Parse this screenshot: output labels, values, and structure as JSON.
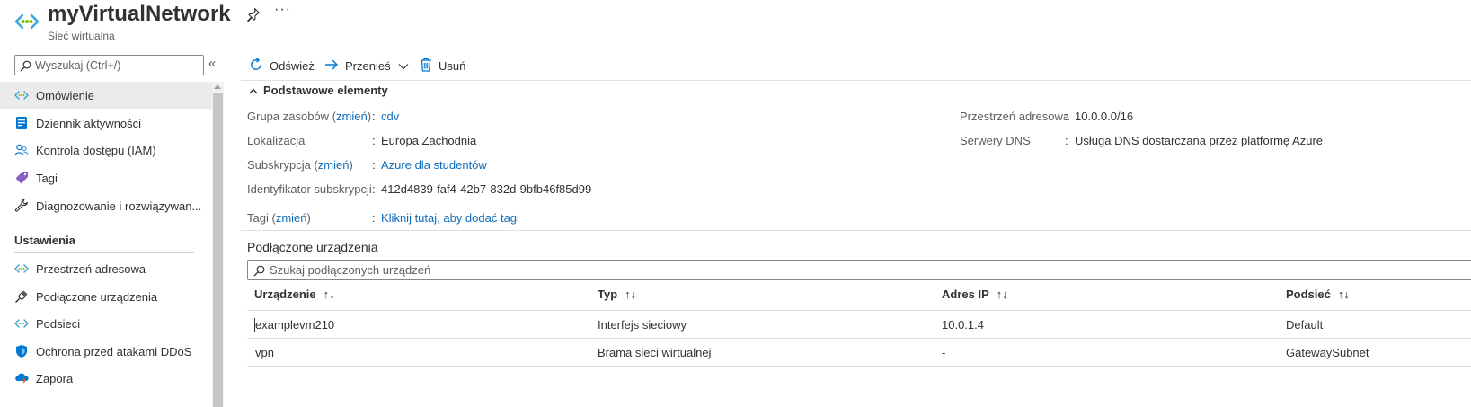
{
  "header": {
    "title": "myVirtualNetwork",
    "subtitle": "Sieć wirtualna",
    "more_label": "···"
  },
  "sidebar": {
    "search": {
      "placeholder": "Wyszukaj (Ctrl+/)"
    },
    "collapse_label": "«",
    "items": [
      {
        "label": "Omówienie",
        "icon": "virtual-network-icon",
        "selected": true
      },
      {
        "label": "Dziennik aktywności",
        "icon": "activity-log-icon"
      },
      {
        "label": "Kontrola dostępu (IAM)",
        "icon": "users-icon"
      },
      {
        "label": "Tagi",
        "icon": "tag-icon"
      },
      {
        "label": "Diagnozowanie i rozwiązywan...",
        "icon": "wrench-icon"
      }
    ],
    "section_title": "Ustawienia",
    "settings_items": [
      {
        "label": "Przestrzeń adresowa",
        "icon": "virtual-network-icon"
      },
      {
        "label": "Podłączone urządzenia",
        "icon": "plug-icon"
      },
      {
        "label": "Podsieci",
        "icon": "virtual-network-icon"
      },
      {
        "label": "Ochrona przed atakami DDoS",
        "icon": "shield-icon"
      },
      {
        "label": "Zapora",
        "icon": "firewall-icon"
      }
    ]
  },
  "toolbar": {
    "refresh_label": "Odśwież",
    "move_label": "Przenieś",
    "delete_label": "Usuń"
  },
  "essentials": {
    "title": "Podstawowe elementy",
    "change_label": "zmień",
    "left": [
      {
        "label": "Grupa zasobów",
        "value": "cdv"
      },
      {
        "label": "Lokalizacja",
        "value": "Europa Zachodnia"
      },
      {
        "label": "Subskrypcja",
        "value": "Azure dla studentów"
      },
      {
        "label": "Identyfikator subskrypcji",
        "value": "412d4839-faf4-42b7-832d-9bfb46f85d99"
      }
    ],
    "right": [
      {
        "label": "Przestrzeń adresowa",
        "value": "10.0.0.0/16"
      },
      {
        "label": "Serwery DNS",
        "value": "Usługa DNS dostarczana przez platformę Azure"
      }
    ],
    "tags": {
      "label": "Tagi",
      "value": "Kliknij tutaj, aby dodać tagi"
    }
  },
  "connected": {
    "title": "Podłączone urządzenia",
    "search_placeholder": "Szukaj podłączonych urządzeń",
    "columns": [
      "Urządzenie",
      "Typ",
      "Adres IP",
      "Podsieć"
    ],
    "sort_symbol": "↑↓",
    "rows": [
      {
        "device": "examplevm210",
        "type": "Interfejs sieciowy",
        "ip": "10.0.1.4",
        "subnet": "Default"
      },
      {
        "device": "vpn",
        "type": "Brama sieci wirtualnej",
        "ip": "-",
        "subnet": "GatewaySubnet"
      }
    ]
  },
  "colors": {
    "link": "#0f6cbd",
    "accent": "#0078d4",
    "selected_bg": "#ebebeb"
  }
}
